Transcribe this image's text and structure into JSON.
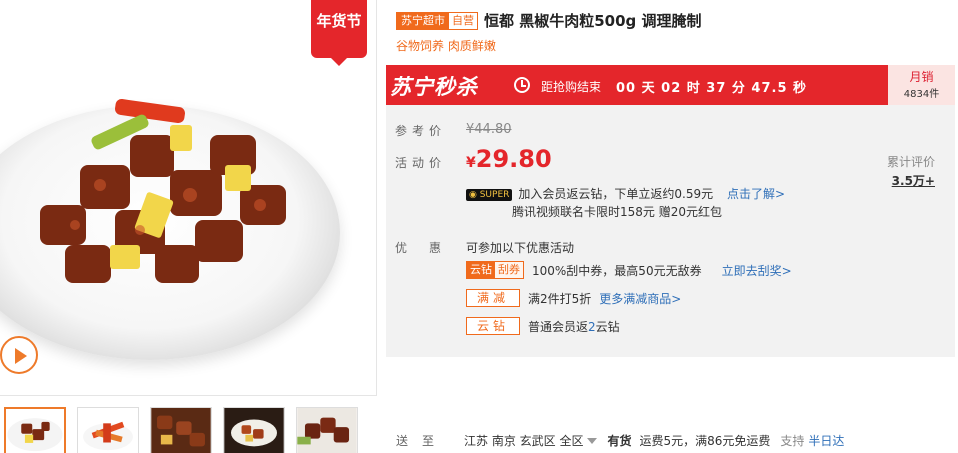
{
  "badge": {
    "nianhuo": "年货节"
  },
  "title": {
    "tag_store": "苏宁超市",
    "tag_self": "自营",
    "name": "恒都 黑椒牛肉粒500g 调理腌制",
    "subtitle": "谷物饲养 肉质鲜嫩"
  },
  "flash": {
    "logo": "苏宁秒杀",
    "countdown_label": "距抢购结束",
    "countdown": "00 天 02 时 37 分 47.5 秒",
    "monthly_label": "月销",
    "monthly_count": "4834件"
  },
  "price": {
    "ref_label": "参考价",
    "ref_value": "¥44.80",
    "act_label": "活动价",
    "currency": "¥",
    "act_value": "29.80",
    "review_label": "累计评价",
    "review_count": "3.5万+"
  },
  "super": {
    "tag": "SUPER",
    "line1": "加入会员返云钻，下单立返约0.59元",
    "line1_link": "点击了解>",
    "line2": "腾讯视频联名卡限时158元 赠20元红包"
  },
  "promo": {
    "label": "优惠",
    "intro": "可参加以下优惠活动",
    "coupon_tag_a": "云钻",
    "coupon_tag_b": "刮券",
    "coupon_text": "100%刮中券，最高50元无敌券",
    "coupon_link": "立即去刮奖>",
    "manjian_tag": "满减",
    "manjian_text": "满2件打5折",
    "manjian_link": "更多满减商品>",
    "yunzuan_tag": "云钻",
    "yunzuan_text_a": "普通会员返",
    "yunzuan_num": "2",
    "yunzuan_text_b": "云钻"
  },
  "ship": {
    "label": "送至",
    "location": "江苏 南京 玄武区 全区",
    "stock": "有货",
    "fee": "运费5元，满86元免运费",
    "support_label": "支持",
    "support_link": "半日达"
  }
}
